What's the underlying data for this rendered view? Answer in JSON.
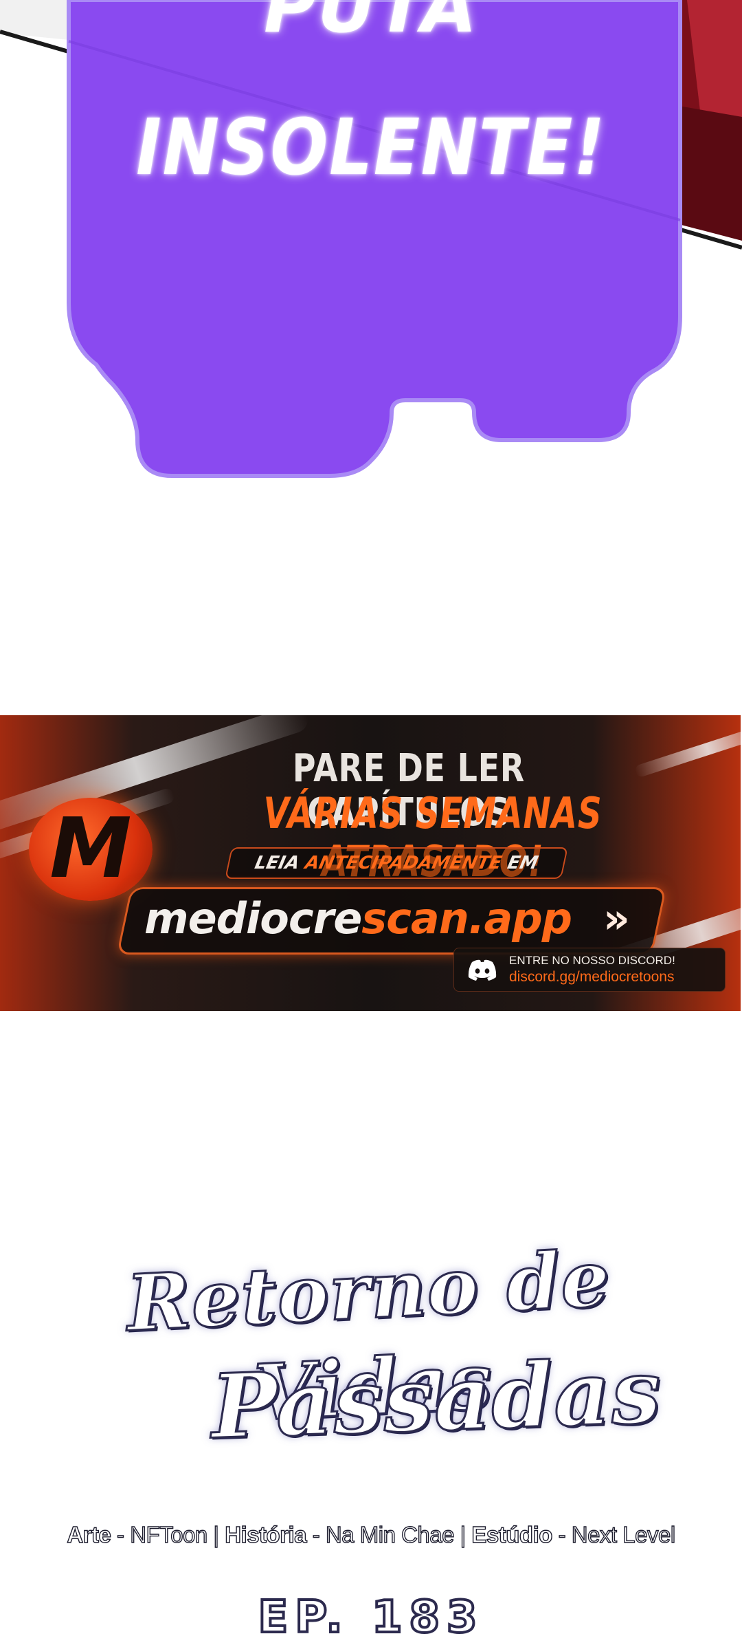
{
  "bubble": {
    "line_1": "PUTA",
    "line_2": "INSOLENTE!",
    "fill_color": "#8a4af0",
    "border_color": "#a98af5"
  },
  "banner": {
    "headline_1": "PARE DE LER CAPÍTULOS",
    "headline_2": "VÁRIAS SEMANAS ATRASADO!",
    "lead_prefix": "LEIA",
    "lead_accent": "ANTECIPADAMENTE",
    "lead_suffix": "EM",
    "url_prefix": "mediocre",
    "url_accent": "scan.app",
    "url_arrow": "»",
    "logo_letter": "M",
    "discord_label": "ENTRE NO NOSSO DISCORD!",
    "discord_link": "discord.gg/mediocretoons",
    "accent_color": "#ff6a1a"
  },
  "title": {
    "line_1": "Retorno de Vidas",
    "line_2": "Passadas"
  },
  "credits": {
    "art_label": "Arte",
    "art_value": "NFToon",
    "story_label": "História",
    "story_value": "Na Min Chae",
    "studio_label": "Estúdio",
    "studio_value": "Next Level",
    "separator": " - ",
    "divider": " | "
  },
  "episode": {
    "label": "EP. 183"
  }
}
